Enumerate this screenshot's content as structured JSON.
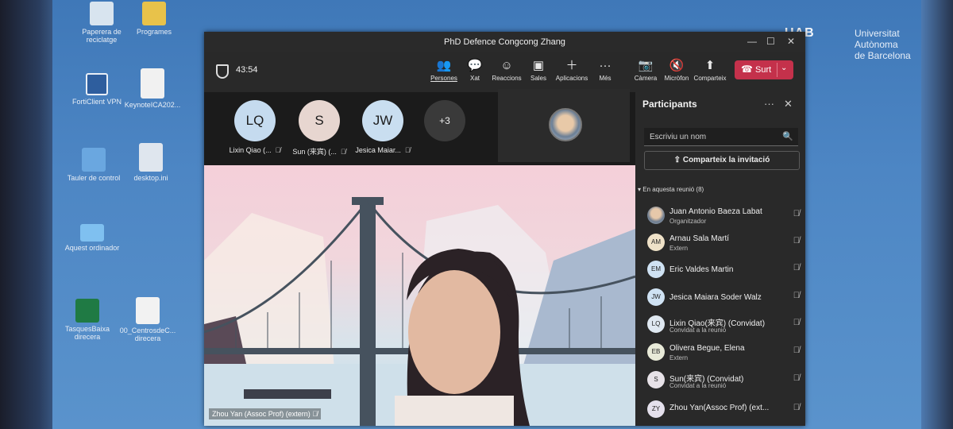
{
  "desktop": {
    "university": [
      "Universitat Autònoma",
      "de Barcelona"
    ],
    "icons": [
      {
        "label": "Paperera de reciclatge"
      },
      {
        "label": "Programes"
      },
      {
        "label": "FortiClient VPN"
      },
      {
        "label": "KeynoteICA202..."
      },
      {
        "label": "Tauler de control"
      },
      {
        "label": "desktop.ini"
      },
      {
        "label": "Aquest ordinador"
      },
      {
        "label": "TasquesBaixa direcera"
      },
      {
        "label": "00_CentrosdeC... direcera"
      }
    ]
  },
  "window": {
    "title": "PhD Defence Congcong Zhang",
    "timer": "43:54",
    "toolbar": {
      "people": "Persones",
      "chat": "Xat",
      "reactions": "Reaccions",
      "rooms": "Sales",
      "apps": "Aplicacions",
      "more": "Més",
      "camera": "Càmera",
      "mic": "Micròfon",
      "share": "Comparteix",
      "leave": "Surt"
    }
  },
  "gallery": [
    {
      "initials": "LQ",
      "name": "Lixin Qiao (...",
      "color": "#c5dbef"
    },
    {
      "initials": "S",
      "name": "Sun (来宾) (...",
      "color": "#e7d6d0"
    },
    {
      "initials": "JW",
      "name": "Jesica Maiar...",
      "color": "#c9def0"
    },
    {
      "initials": "+3",
      "name": "",
      "color": "#3a3a3a"
    }
  ],
  "stage": {
    "speaker": "Zhou Yan (Assoc Prof) (extern)"
  },
  "panel": {
    "title": "Participants",
    "search_placeholder": "Escriviu un nom",
    "invite": "Comparteix la invitació",
    "section": "En aquesta reunió (8)",
    "participants": [
      {
        "initials": "",
        "name": "Juan Antonio Baeza Labat",
        "role": "Organitzador",
        "color": "#9aa6b2"
      },
      {
        "initials": "AM",
        "name": "Arnau Sala Martí",
        "role": "Extern",
        "color": "#efe2c8"
      },
      {
        "initials": "EM",
        "name": "Eric Valdes Martin",
        "role": "",
        "color": "#cfe2f3"
      },
      {
        "initials": "JW",
        "name": "Jesica Maiara Soder Walz",
        "role": "",
        "color": "#cfe2f3"
      },
      {
        "initials": "LQ",
        "name": "Lixin Qiao(来宾) (Convidat)",
        "role": "Convidat a la reunió",
        "color": "#dfe8f1"
      },
      {
        "initials": "EB",
        "name": "Olivera Begue, Elena",
        "role": "Extern",
        "color": "#e8ead8"
      },
      {
        "initials": "S",
        "name": "Sun(来宾) (Convidat)",
        "role": "Convidat a la reunió",
        "color": "#e7e2e8"
      },
      {
        "initials": "ZY",
        "name": "Zhou Yan(Assoc Prof) (ext...",
        "role": "",
        "color": "#e4e0ec"
      }
    ]
  }
}
